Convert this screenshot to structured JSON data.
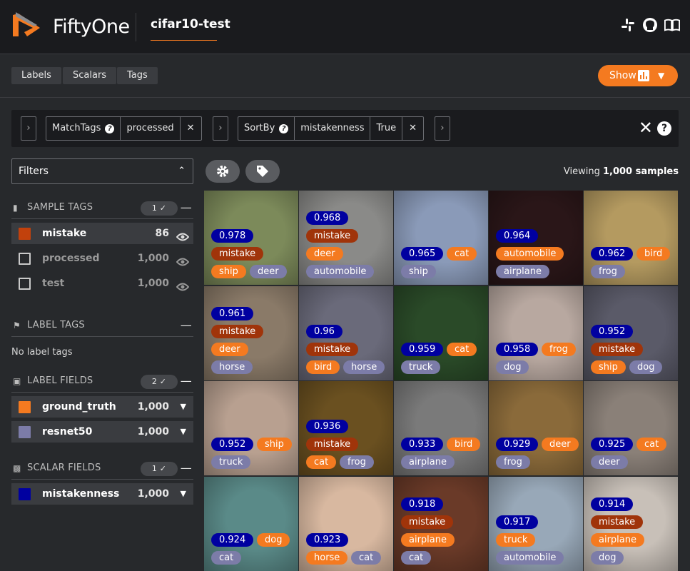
{
  "header": {
    "brand": "FiftyOne",
    "dataset": "cifar10-test"
  },
  "toolbar": {
    "labels": "Labels",
    "scalars": "Scalars",
    "tags": "Tags",
    "show": "Show"
  },
  "view_bar": {
    "stages": [
      {
        "name": "MatchTags",
        "params": [
          "processed"
        ]
      },
      {
        "name": "SortBy",
        "params": [
          "mistakenness",
          "True"
        ]
      }
    ]
  },
  "sidebar": {
    "filters": "Filters",
    "sample_tags": {
      "title": "SAMPLE TAGS",
      "count": "1",
      "items": [
        {
          "label": "mistake",
          "count": "86",
          "checked": true,
          "color": "#c2410c"
        },
        {
          "label": "processed",
          "count": "1,000",
          "checked": false
        },
        {
          "label": "test",
          "count": "1,000",
          "checked": false
        }
      ]
    },
    "label_tags": {
      "title": "LABEL TAGS",
      "empty": "No label tags"
    },
    "label_fields": {
      "title": "LABEL FIELDS",
      "count": "2",
      "items": [
        {
          "label": "ground_truth",
          "count": "1,000",
          "color": "#f47a20"
        },
        {
          "label": "resnet50",
          "count": "1,000",
          "color": "#7c7ca8"
        }
      ]
    },
    "scalar_fields": {
      "title": "SCALAR FIELDS",
      "count": "1",
      "items": [
        {
          "label": "mistakenness",
          "count": "1,000",
          "color": "#0000a0"
        }
      ]
    }
  },
  "grid": {
    "viewing_prefix": "Viewing ",
    "viewing_count": "1,000 samples",
    "colors": {
      "score": "#0000a0",
      "mistake": "#a0340a",
      "ground_truth": "#f47a20",
      "prediction": "#7c7ca8"
    },
    "tiles": [
      {
        "bg": "#7c8a5a",
        "rows": [
          [
            "0.978"
          ],
          [
            "mistake"
          ],
          [
            "ship",
            "deer"
          ]
        ],
        "types": [
          [
            "score"
          ],
          [
            "mistake"
          ],
          [
            "ground_truth",
            "prediction"
          ]
        ]
      },
      {
        "bg": "#8a8a88",
        "rows": [
          [
            "0.968"
          ],
          [
            "mistake"
          ],
          [
            "deer"
          ],
          [
            "automobile"
          ]
        ],
        "types": [
          [
            "score"
          ],
          [
            "mistake"
          ],
          [
            "ground_truth"
          ],
          [
            "prediction"
          ]
        ]
      },
      {
        "bg": "#8a9ab8",
        "rows": [
          [
            "0.965",
            "cat"
          ],
          [
            "ship"
          ]
        ],
        "types": [
          [
            "score",
            "ground_truth"
          ],
          [
            "prediction"
          ]
        ]
      },
      {
        "bg": "#2a1618",
        "rows": [
          [
            "0.964"
          ],
          [
            "automobile"
          ],
          [
            "airplane"
          ]
        ],
        "types": [
          [
            "score"
          ],
          [
            "ground_truth"
          ],
          [
            "prediction"
          ]
        ]
      },
      {
        "bg": "#b49a60",
        "rows": [
          [
            "0.962",
            "bird"
          ],
          [
            "frog"
          ]
        ],
        "types": [
          [
            "score",
            "ground_truth"
          ],
          [
            "prediction"
          ]
        ]
      },
      {
        "bg": "#8a7a68",
        "rows": [
          [
            "0.961"
          ],
          [
            "mistake"
          ],
          [
            "deer"
          ],
          [
            "horse"
          ]
        ],
        "types": [
          [
            "score"
          ],
          [
            "mistake"
          ],
          [
            "ground_truth"
          ],
          [
            "prediction"
          ]
        ]
      },
      {
        "bg": "#6a6a7a",
        "rows": [
          [
            "0.96"
          ],
          [
            "mistake"
          ],
          [
            "bird",
            "horse"
          ]
        ],
        "types": [
          [
            "score"
          ],
          [
            "mistake"
          ],
          [
            "ground_truth",
            "prediction"
          ]
        ]
      },
      {
        "bg": "#2a4a28",
        "rows": [
          [
            "0.959",
            "cat"
          ],
          [
            "truck"
          ]
        ],
        "types": [
          [
            "score",
            "ground_truth"
          ],
          [
            "prediction"
          ]
        ]
      },
      {
        "bg": "#b8a8a0",
        "rows": [
          [
            "0.958",
            "frog"
          ],
          [
            "dog"
          ]
        ],
        "types": [
          [
            "score",
            "ground_truth"
          ],
          [
            "prediction"
          ]
        ]
      },
      {
        "bg": "#5a5a68",
        "rows": [
          [
            "0.952"
          ],
          [
            "mistake"
          ],
          [
            "ship",
            "dog"
          ]
        ],
        "types": [
          [
            "score"
          ],
          [
            "mistake"
          ],
          [
            "ground_truth",
            "prediction"
          ]
        ]
      },
      {
        "bg": "#b8a090",
        "rows": [
          [
            "0.952",
            "ship"
          ],
          [
            "truck"
          ]
        ],
        "types": [
          [
            "score",
            "ground_truth"
          ],
          [
            "prediction"
          ]
        ]
      },
      {
        "bg": "#6a5020",
        "rows": [
          [
            "0.936"
          ],
          [
            "mistake"
          ],
          [
            "cat",
            "frog"
          ]
        ],
        "types": [
          [
            "score"
          ],
          [
            "mistake"
          ],
          [
            "ground_truth",
            "prediction"
          ]
        ]
      },
      {
        "bg": "#7a7a7a",
        "rows": [
          [
            "0.933",
            "bird"
          ],
          [
            "airplane"
          ]
        ],
        "types": [
          [
            "score",
            "ground_truth"
          ],
          [
            "prediction"
          ]
        ]
      },
      {
        "bg": "#8a6a3a",
        "rows": [
          [
            "0.929",
            "deer"
          ],
          [
            "frog"
          ]
        ],
        "types": [
          [
            "score",
            "ground_truth"
          ],
          [
            "prediction"
          ]
        ]
      },
      {
        "bg": "#8a8078",
        "rows": [
          [
            "0.925",
            "cat"
          ],
          [
            "deer"
          ]
        ],
        "types": [
          [
            "score",
            "ground_truth"
          ],
          [
            "prediction"
          ]
        ]
      },
      {
        "bg": "#5a8a88",
        "rows": [
          [
            "0.924",
            "dog"
          ],
          [
            "cat"
          ]
        ],
        "types": [
          [
            "score",
            "ground_truth"
          ],
          [
            "prediction"
          ]
        ]
      },
      {
        "bg": "#d8b8a0",
        "rows": [
          [
            "0.923"
          ],
          [
            "horse",
            "cat"
          ]
        ],
        "types": [
          [
            "score"
          ],
          [
            "ground_truth",
            "prediction"
          ]
        ]
      },
      {
        "bg": "#6a3a28",
        "rows": [
          [
            "0.918"
          ],
          [
            "mistake"
          ],
          [
            "airplane"
          ],
          [
            "cat"
          ]
        ],
        "types": [
          [
            "score"
          ],
          [
            "mistake"
          ],
          [
            "ground_truth"
          ],
          [
            "prediction"
          ]
        ]
      },
      {
        "bg": "#98a8b8",
        "rows": [
          [
            "0.917"
          ],
          [
            "truck"
          ],
          [
            "automobile"
          ]
        ],
        "types": [
          [
            "score"
          ],
          [
            "ground_truth"
          ],
          [
            "prediction"
          ]
        ]
      },
      {
        "bg": "#c8c0b8",
        "rows": [
          [
            "0.914"
          ],
          [
            "mistake"
          ],
          [
            "airplane"
          ],
          [
            "dog"
          ]
        ],
        "types": [
          [
            "score"
          ],
          [
            "mistake"
          ],
          [
            "ground_truth"
          ],
          [
            "prediction"
          ]
        ]
      }
    ]
  }
}
